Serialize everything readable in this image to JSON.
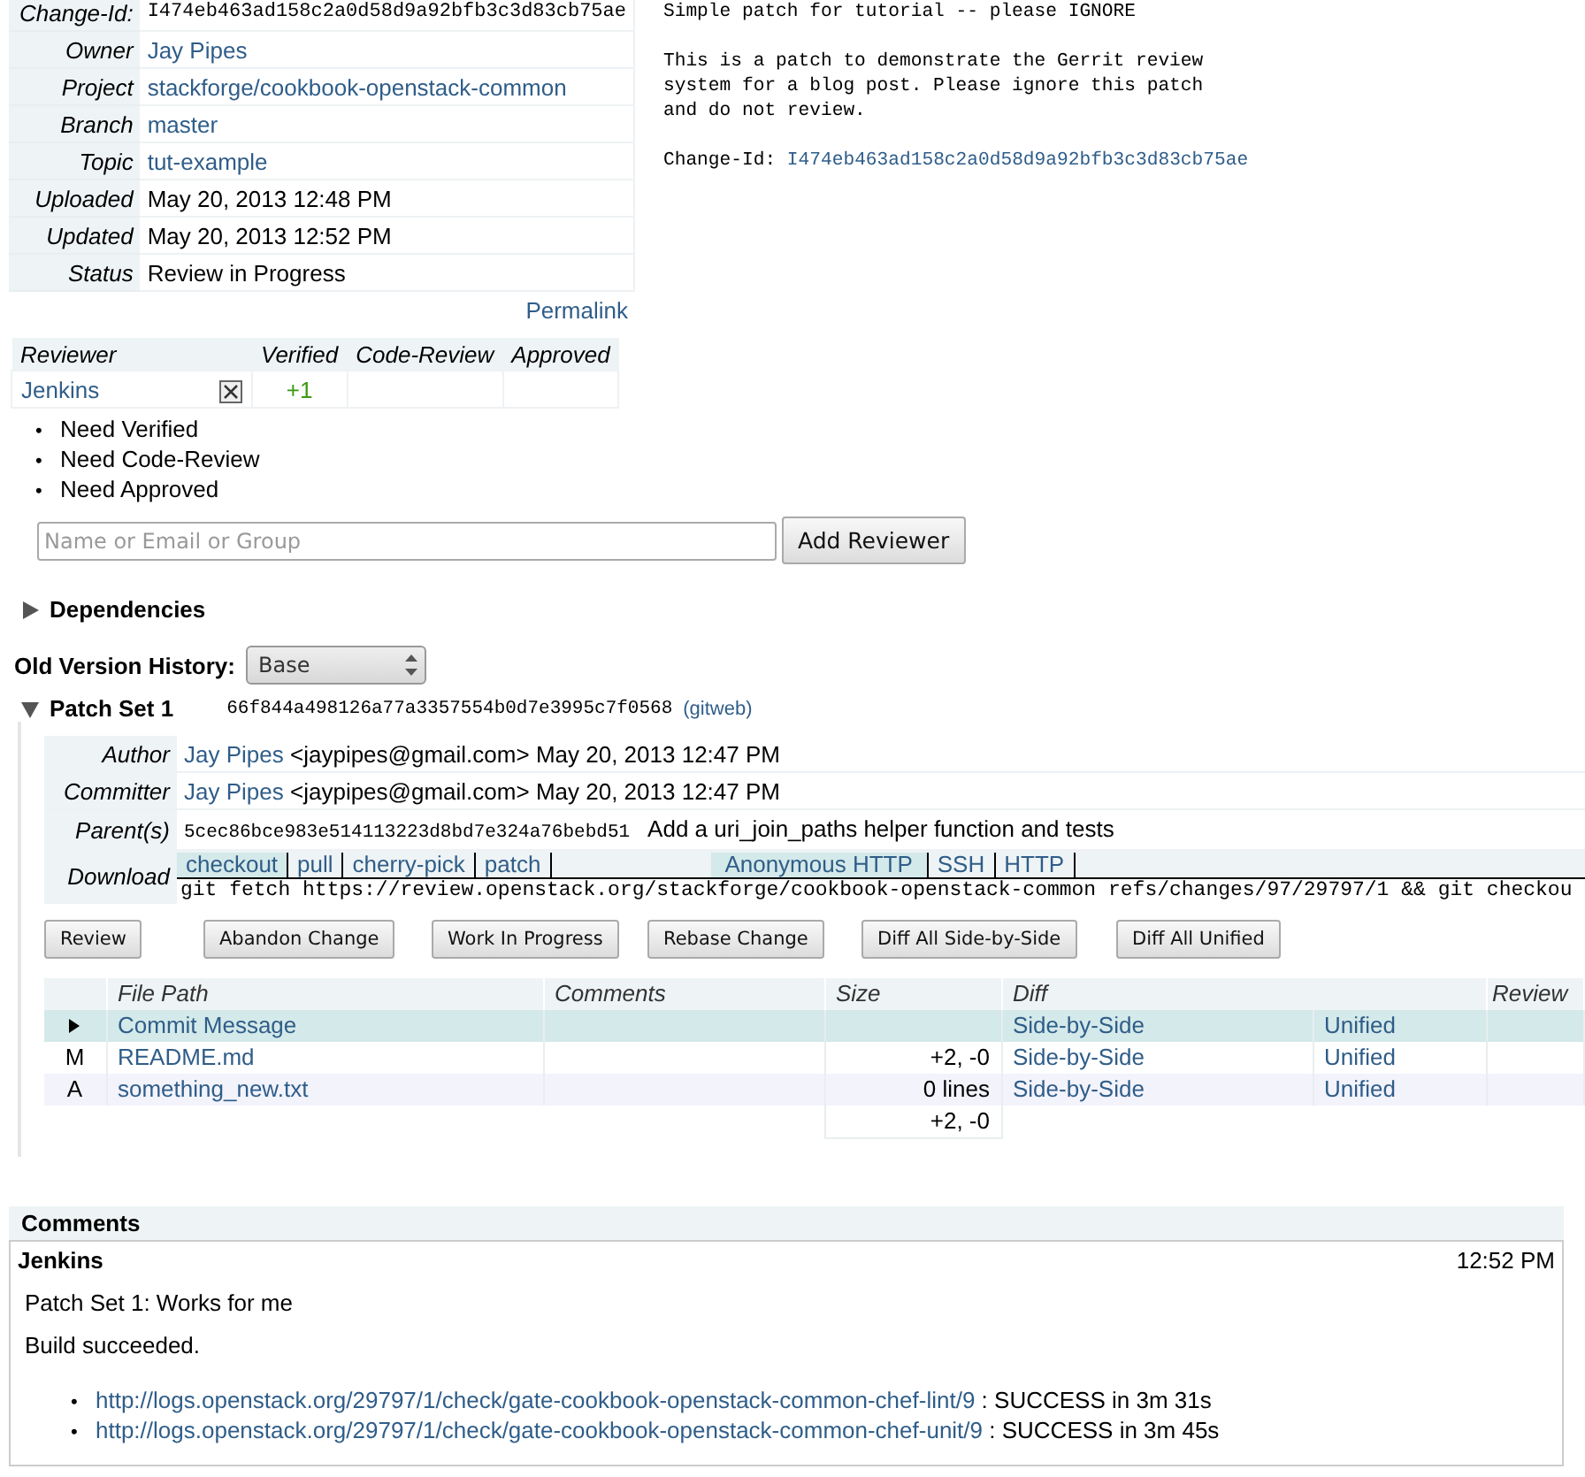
{
  "change_info": {
    "rows": [
      {
        "label": "Change-Id:",
        "value": "I474eb463ad158c2a0d58d9a92bfb3c3d83cb75ae",
        "kind": "mono"
      },
      {
        "label": "Owner",
        "value": "Jay Pipes",
        "kind": "link"
      },
      {
        "label": "Project",
        "value": "stackforge/cookbook-openstack-common",
        "kind": "link"
      },
      {
        "label": "Branch",
        "value": "master",
        "kind": "link"
      },
      {
        "label": "Topic",
        "value": "tut-example",
        "kind": "link"
      },
      {
        "label": "Uploaded",
        "value": "May 20, 2013 12:48 PM",
        "kind": "text"
      },
      {
        "label": "Updated",
        "value": "May 20, 2013 12:52 PM",
        "kind": "text"
      },
      {
        "label": "Status",
        "value": "Review in Progress",
        "kind": "text"
      }
    ],
    "permalink": "Permalink"
  },
  "commit_message": {
    "subject": "Simple patch for tutorial -- please IGNORE",
    "body": [
      "This is a patch to demonstrate the Gerrit review",
      "system for a blog post. Please ignore this patch",
      "and do not review."
    ],
    "change_id_label": "Change-Id:",
    "change_id": "I474eb463ad158c2a0d58d9a92bfb3c3d83cb75ae"
  },
  "reviewers": {
    "columns": [
      "Reviewer",
      "Verified",
      "Code-Review",
      "Approved"
    ],
    "rows": [
      {
        "name": "Jenkins",
        "verified": "+1",
        "removable": true
      }
    ]
  },
  "needs": [
    {
      "marker": "•",
      "text": "Need Verified"
    },
    {
      "marker": "•",
      "text": "Need Code-Review"
    },
    {
      "marker": "•",
      "text": "Need Approved"
    }
  ],
  "add_reviewer": {
    "placeholder": "Name or Email or Group",
    "button": "Add Reviewer"
  },
  "dependencies": {
    "label": "Dependencies",
    "expanded": false
  },
  "old_version_history": {
    "label": "Old Version History:",
    "value": "Base"
  },
  "patch_set": {
    "title": "Patch Set 1",
    "expanded": true,
    "commit": "66f844a498126a77a3357554b0d7e3995c7f0568",
    "gitweb": "(gitweb)",
    "people": [
      {
        "label": "Author",
        "name": "Jay Pipes",
        "email": "<jaypipes@gmail.com>",
        "date": "May 20, 2013 12:47 PM"
      },
      {
        "label": "Committer",
        "name": "Jay Pipes",
        "email": "<jaypipes@gmail.com>",
        "date": "May 20, 2013 12:47 PM"
      }
    ],
    "parent": {
      "label": "Parent(s)",
      "commit": "5cec86bce983e514113223d8bd7e324a76bebd51",
      "subject": "Add a uri_join_paths helper function and tests"
    },
    "download": {
      "label": "Download",
      "commands": [
        {
          "label": "checkout",
          "selected": true
        },
        {
          "label": "pull",
          "selected": false
        },
        {
          "label": "cherry-pick",
          "selected": false
        },
        {
          "label": "patch",
          "selected": false
        }
      ],
      "protocols": [
        {
          "label": "Anonymous HTTP",
          "selected": true
        },
        {
          "label": "SSH",
          "selected": false
        },
        {
          "label": "HTTP",
          "selected": false
        }
      ],
      "command": "git fetch https://review.openstack.org/stackforge/cookbook-openstack-common refs/changes/97/29797/1 && git checkou"
    },
    "buttons": [
      "Review",
      "Abandon Change",
      "Work In Progress",
      "Rebase Change",
      "Diff All Side-by-Side",
      "Diff All Unified"
    ],
    "files": {
      "columns": [
        "File Path",
        "Comments",
        "Size",
        "Diff",
        "Review"
      ],
      "rows": [
        {
          "status": "",
          "path": "Commit Message",
          "size": "",
          "side": "Side-by-Side",
          "unified": "Unified",
          "selected": true
        },
        {
          "status": "M",
          "path": "README.md",
          "size": "+2, -0",
          "side": "Side-by-Side",
          "unified": "Unified",
          "selected": false
        },
        {
          "status": "A",
          "path": "something_new.txt",
          "size": "0 lines",
          "side": "Side-by-Side",
          "unified": "Unified",
          "selected": false
        }
      ],
      "total": "+2, -0"
    }
  },
  "comments": {
    "title": "Comments",
    "author": "Jenkins",
    "time": "12:52 PM",
    "paragraphs": [
      "Patch Set 1: Works for me",
      "Build succeeded."
    ],
    "links": [
      {
        "marker": "•",
        "url": "http://logs.openstack.org/29797/1/check/gate-cookbook-openstack-common-chef-lint/9",
        "result": ": SUCCESS in 3m 31s"
      },
      {
        "marker": "•",
        "url": "http://logs.openstack.org/29797/1/check/gate-cookbook-openstack-common-chef-unit/9",
        "result": ": SUCCESS in 3m 45s"
      }
    ]
  }
}
